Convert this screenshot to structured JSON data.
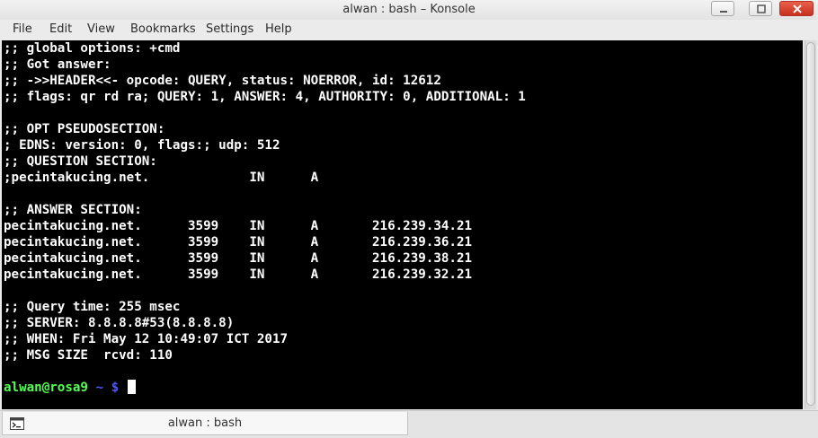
{
  "window": {
    "title": "alwan : bash – Konsole"
  },
  "menu": [
    "File",
    "Edit",
    "View",
    "Bookmarks",
    "Settings",
    "Help"
  ],
  "terminal": {
    "lines": [
      ";; global options: +cmd",
      ";; Got answer:",
      ";; ->>HEADER<<- opcode: QUERY, status: NOERROR, id: 12612",
      ";; flags: qr rd ra; QUERY: 1, ANSWER: 4, AUTHORITY: 0, ADDITIONAL: 1",
      "",
      ";; OPT PSEUDOSECTION:",
      "; EDNS: version: 0, flags:; udp: 512",
      ";; QUESTION SECTION:",
      ";pecintakucing.net.             IN      A",
      "",
      ";; ANSWER SECTION:",
      "pecintakucing.net.      3599    IN      A       216.239.34.21",
      "pecintakucing.net.      3599    IN      A       216.239.36.21",
      "pecintakucing.net.      3599    IN      A       216.239.38.21",
      "pecintakucing.net.      3599    IN      A       216.239.32.21",
      "",
      ";; Query time: 255 msec",
      ";; SERVER: 8.8.8.8#53(8.8.8.8)",
      ";; WHEN: Fri May 12 10:49:07 ICT 2017",
      ";; MSG SIZE  rcvd: 110",
      ""
    ],
    "prompt": {
      "user_host": "alwan@rosa9",
      "dir": "~",
      "symbol": "$"
    },
    "colors": {
      "background": "#000000",
      "text": "#ffffff",
      "user": "#54ff54",
      "path": "#5454ff"
    }
  },
  "tabs": [
    {
      "label": "alwan : bash",
      "icon": "terminal-icon"
    }
  ]
}
